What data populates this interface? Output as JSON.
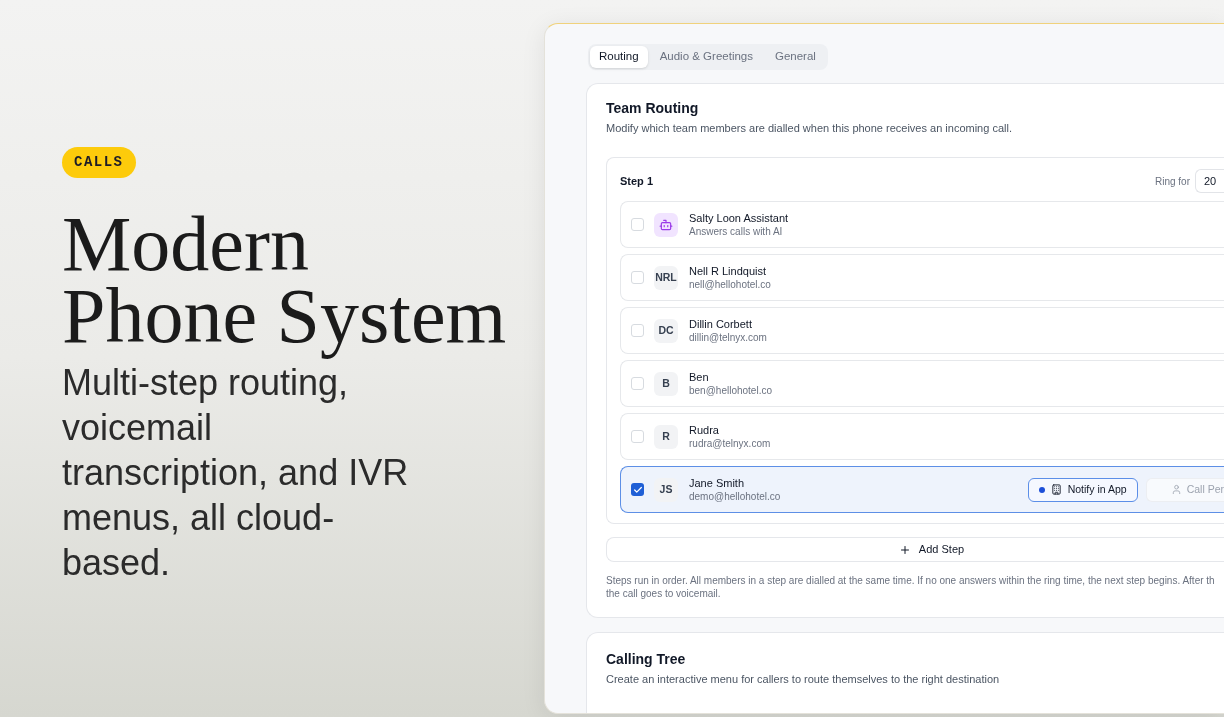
{
  "hero": {
    "badge": "CALLS",
    "title": "Modern Phone System",
    "subtitle": "Multi-step routing, voicemail transcription, and IVR menus, all cloud-based."
  },
  "tabs": [
    {
      "label": "Routing",
      "selected": true
    },
    {
      "label": "Audio & Greetings",
      "selected": false
    },
    {
      "label": "General",
      "selected": false
    }
  ],
  "team_routing": {
    "title": "Team Routing",
    "description": "Modify which team members are dialled when this phone receives an incoming call.",
    "steps": [
      {
        "title": "Step 1",
        "ring_label": "Ring for",
        "ring_value": "20",
        "members": [
          {
            "kind": "assistant",
            "name": "Salty Loon Assistant",
            "detail": "Answers calls with AI",
            "checked": false
          },
          {
            "kind": "person",
            "initials": "NRL",
            "name": "Nell R Lindquist",
            "detail": "nell@hellohotel.co",
            "checked": false
          },
          {
            "kind": "person",
            "initials": "DC",
            "name": "Dillin Corbett",
            "detail": "dillin@telnyx.com",
            "checked": false
          },
          {
            "kind": "person",
            "initials": "B",
            "name": "Ben",
            "detail": "ben@hellohotel.co",
            "checked": false
          },
          {
            "kind": "person",
            "initials": "R",
            "name": "Rudra",
            "detail": "rudra@telnyx.com",
            "checked": false
          },
          {
            "kind": "person",
            "initials": "JS",
            "name": "Jane Smith",
            "detail": "demo@hellohotel.co",
            "checked": true,
            "actions": [
              {
                "kind": "app",
                "label": "Notify in App",
                "selected": true
              },
              {
                "kind": "call",
                "label": "Call Per",
                "selected": false
              }
            ]
          }
        ]
      }
    ],
    "add_step": "Add Step",
    "note_lines": [
      "Steps run in order. All members in a step are dialled at the same time. If no one answers within the ring time, the next step begins. After th",
      "the call goes to voicemail."
    ]
  },
  "calling_tree": {
    "title": "Calling Tree",
    "description": "Create an interactive menu for callers to route themselves to the right destination"
  }
}
